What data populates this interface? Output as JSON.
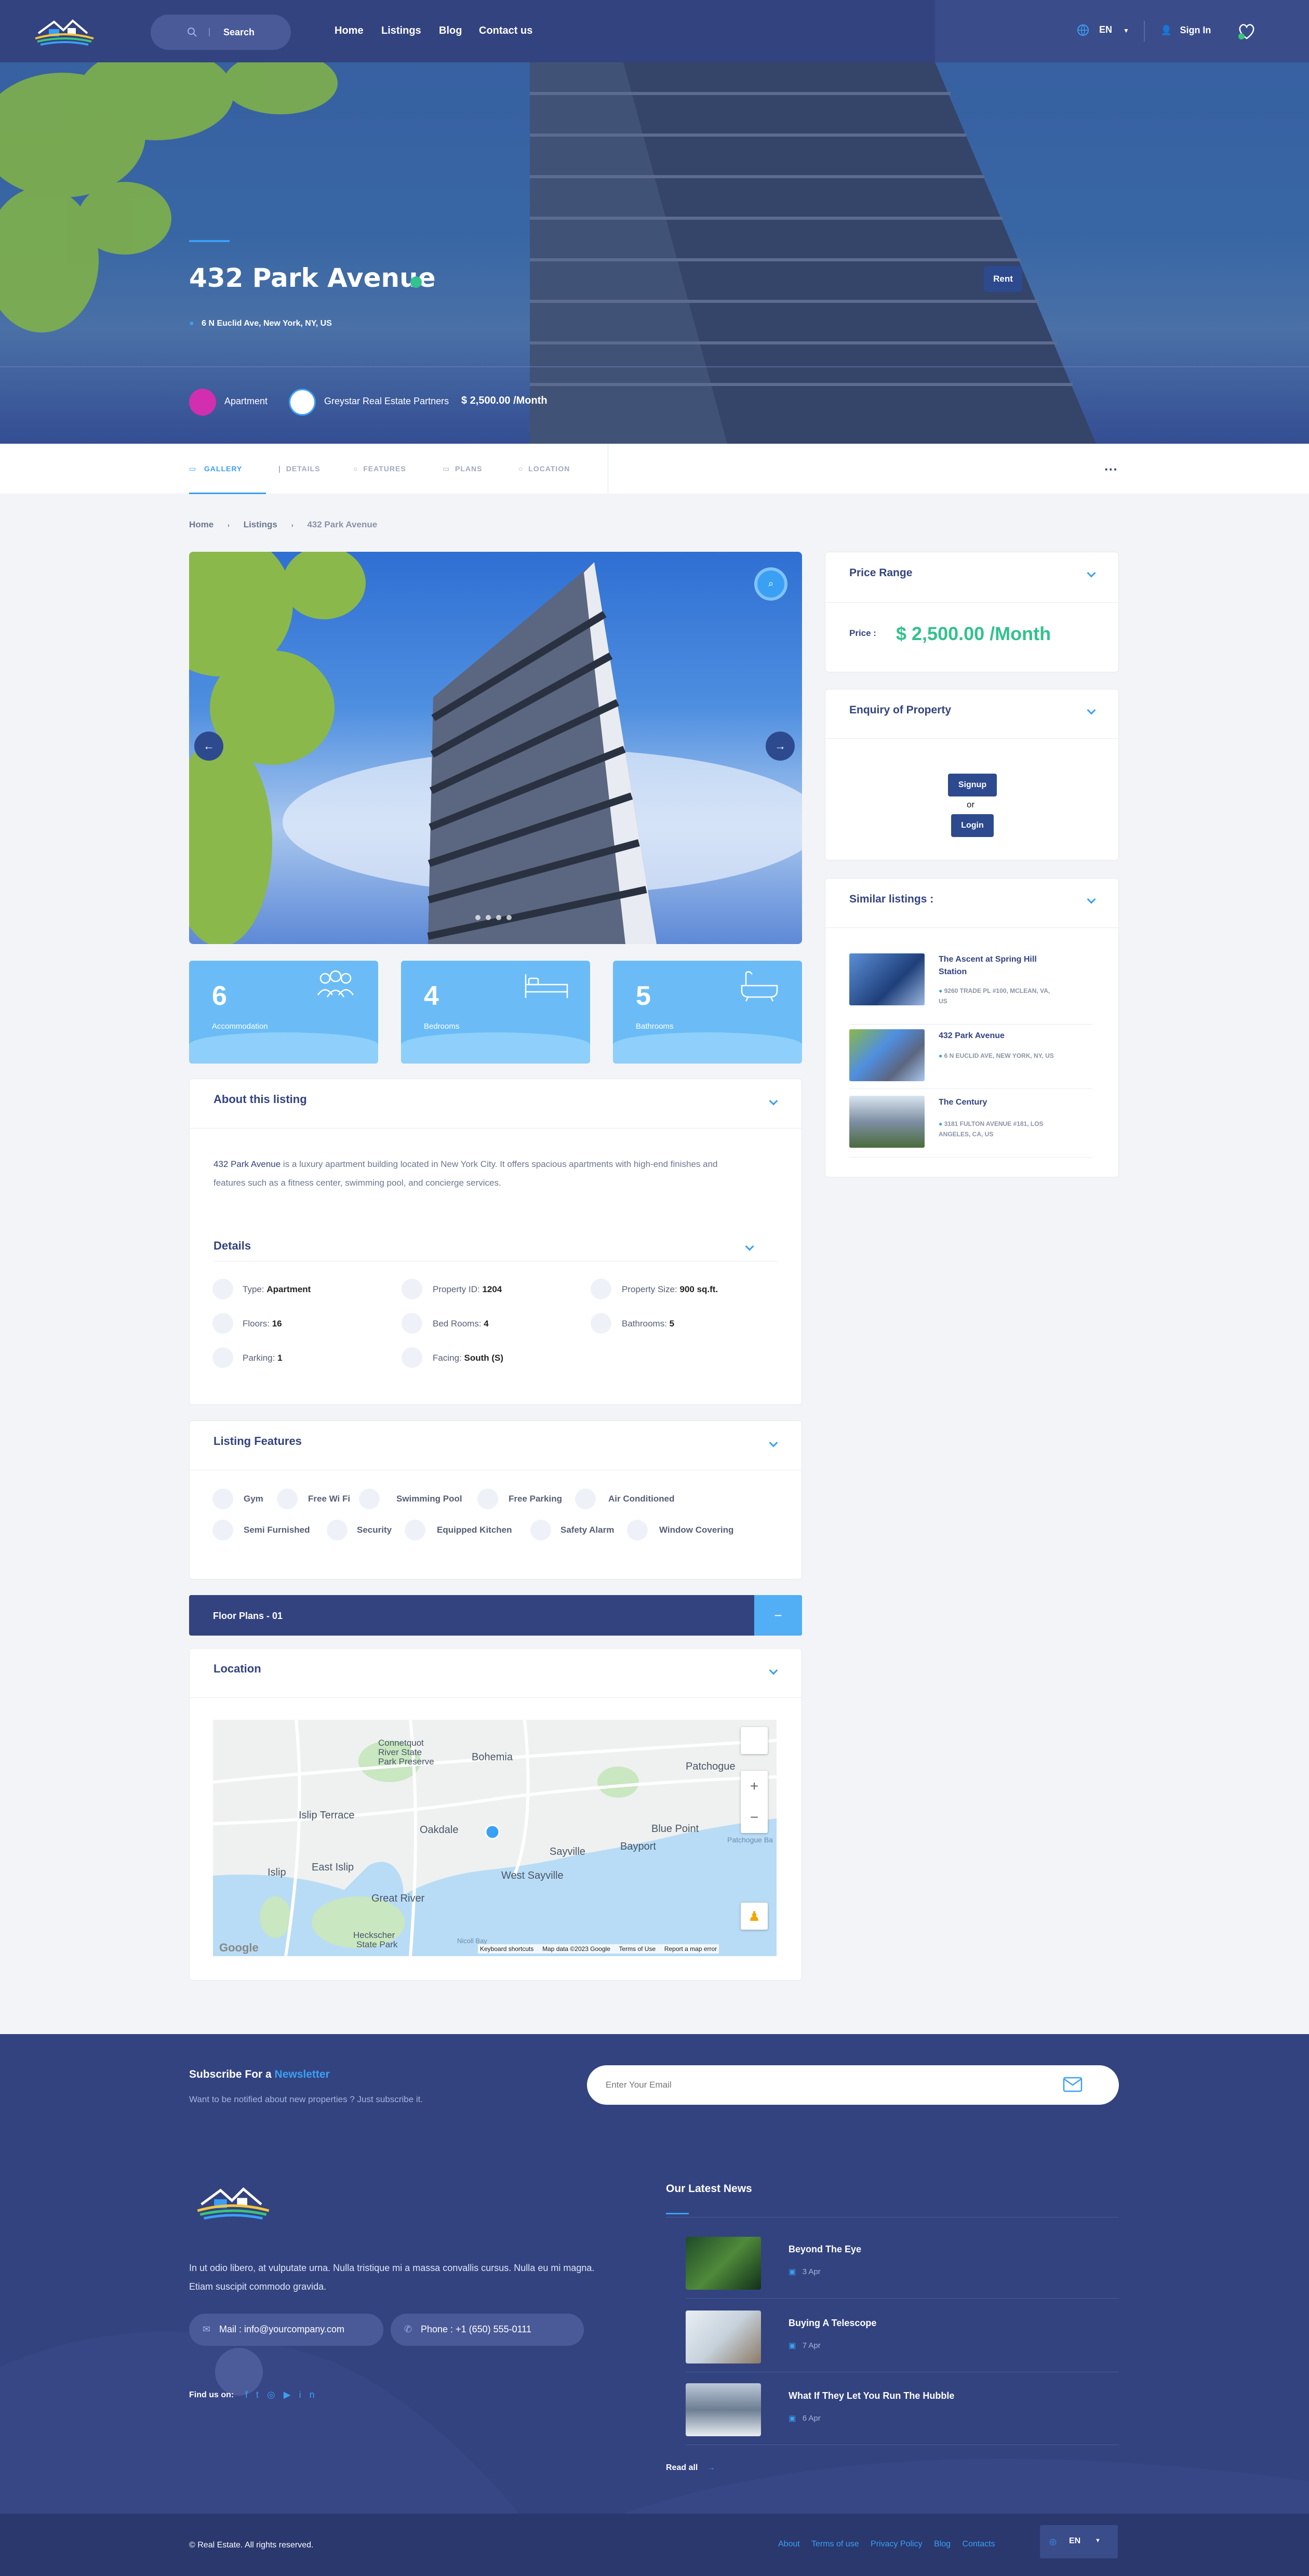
{
  "header": {
    "search_label": "Search",
    "nav": [
      "Home",
      "Listings",
      "Blog",
      "Contact us"
    ],
    "lang": "EN",
    "signin": "Sign In"
  },
  "hero": {
    "title": "432 Park Avenue",
    "address": "6 N Euclid Ave, New York, NY, US",
    "badge": "Rent",
    "type": "Apartment",
    "agent": "Greystar Real Estate Partners",
    "price": "$ 2,500.00 /Month"
  },
  "tabs": [
    "GALLERY",
    "DETAILS",
    "FEATURES",
    "PLANS",
    "LOCATION"
  ],
  "breadcrumb": [
    "Home",
    "Listings",
    "432 Park Avenue"
  ],
  "stats": [
    {
      "value": "6",
      "label": "Accommodation",
      "icon": "people-icon"
    },
    {
      "value": "4",
      "label": "Bedrooms",
      "icon": "bed-icon"
    },
    {
      "value": "5",
      "label": "Bathrooms",
      "icon": "bathtub-icon"
    }
  ],
  "about": {
    "title": "About this listing",
    "lead": "432 Park Avenue",
    "text_line1": " is a luxury apartment building located in New York City. It offers spacious apartments with high-end finishes and",
    "text_line2": "features such as a fitness center, swimming pool, and concierge services."
  },
  "details": {
    "title": "Details",
    "items": [
      {
        "label": "Type:",
        "value": "Apartment"
      },
      {
        "label": "Property ID:",
        "value": "1204"
      },
      {
        "label": "Property Size:",
        "value": "900 sq.ft."
      },
      {
        "label": "Floors:",
        "value": "16"
      },
      {
        "label": "Bed Rooms:",
        "value": "4"
      },
      {
        "label": "Bathrooms:",
        "value": "5"
      },
      {
        "label": "Parking:",
        "value": "1"
      },
      {
        "label": "Facing:",
        "value": "South (S)"
      }
    ]
  },
  "features": {
    "title": "Listing Features",
    "items": [
      "Gym",
      "Free Wi Fi",
      "Swimming Pool",
      "Free Parking",
      "Air Conditioned",
      "Semi Furnished",
      "Security",
      "Equipped Kitchen",
      "Safety Alarm",
      "Window Covering"
    ]
  },
  "floorplan": {
    "label": "Floor Plans - 01",
    "toggle": "−"
  },
  "location": {
    "title": "Location",
    "map_labels": [
      "Connetquot River State Park Preserve",
      "Bohemia",
      "Patchogue",
      "Islip Terrace",
      "Oakdale",
      "Blue Point",
      "Sayville",
      "Bayport",
      "East Islip",
      "West Sayville",
      "Islip",
      "Great River",
      "Heckscher State Park",
      "Patchogue Bay",
      "Nicoll Bay"
    ],
    "map_footer": [
      "Keyboard shortcuts",
      "Map data ©2023 Google",
      "Terms of Use",
      "Report a map error"
    ],
    "google": "Google"
  },
  "sidebar": {
    "price_title": "Price Range",
    "price_label": "Price :",
    "price_value": "$ 2,500.00 /Month",
    "enquiry_title": "Enquiry of Property",
    "signup": "Signup",
    "or": "or",
    "login": "Login",
    "similar_title": "Similar listings :",
    "similar": [
      {
        "name_l1": "The Ascent at Spring Hill",
        "name_l2": "Station",
        "addr_l1": "9260 TRADE PL #100, MCLEAN, VA,",
        "addr_l2": "US"
      },
      {
        "name_l1": "432 Park Avenue",
        "name_l2": "",
        "addr_l1": "6 N EUCLID AVE, NEW YORK, NY, US",
        "addr_l2": ""
      },
      {
        "name_l1": "The Century",
        "name_l2": "",
        "addr_l1": "3181 FULTON AVENUE #181, LOS",
        "addr_l2": "ANGELES, CA, US"
      }
    ]
  },
  "newsletter": {
    "title_a": "Subscribe For a ",
    "title_b": "Newsletter",
    "subtitle": "Want to be notified about new properties ? Just subscribe it.",
    "placeholder": "Enter Your Email"
  },
  "footer": {
    "about_l1": "In ut odio libero, at vulputate urna. Nulla tristique mi a massa convallis cursus. Nulla eu mi magna.",
    "about_l2": "Etiam suscipit commodo gravida.",
    "mail": "Mail : info@yourcompany.com",
    "phone": "Phone : +1 (650) 555-0111",
    "find_us": "Find us on:",
    "news_title": "Our Latest News",
    "news": [
      {
        "title": "Beyond The Eye",
        "date": "3 Apr"
      },
      {
        "title": "Buying A Telescope",
        "date": "7 Apr"
      },
      {
        "title": "What If They Let You Run The Hubble",
        "date": "6 Apr"
      }
    ],
    "read_all": "Read all",
    "copyright": "© Real Estate. All rights reserved.",
    "links": [
      "About",
      "Terms of use",
      "Privacy Policy",
      "Blog",
      "Contacts"
    ],
    "lang": "EN"
  },
  "colors": {
    "primary": "#33437f",
    "accent": "#3aa0f4",
    "price": "#33c18e",
    "tile": "#6bbcf6"
  }
}
